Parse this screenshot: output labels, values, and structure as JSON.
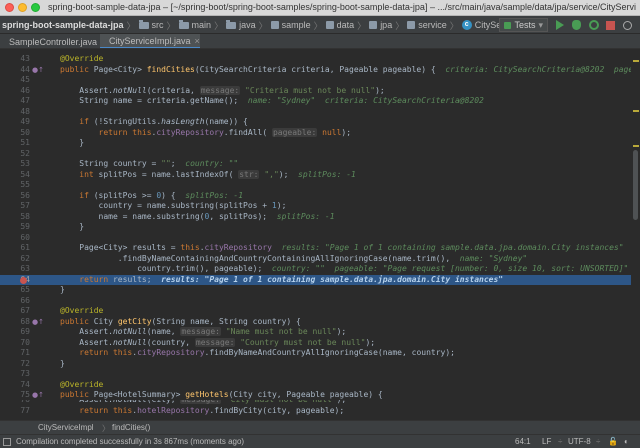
{
  "window": {
    "title": "spring-boot-sample-data-jpa – [~/spring-boot/spring-boot-samples/spring-boot-sample-data-jpa] – .../src/main/java/sample/data/jpa/service/CityServiceImpl"
  },
  "breadcrumbs": [
    "spring-boot-sample-data-jpa",
    "src",
    "main",
    "java",
    "sample",
    "data",
    "jpa",
    "service",
    "CityServiceImpl"
  ],
  "toolbar": {
    "run_config": "Tests"
  },
  "tabs": [
    {
      "label": "SampleController.java",
      "close": "×"
    },
    {
      "label": "CityServiceImpl.java",
      "close": "×"
    }
  ],
  "bottom_breadcrumbs": [
    "CityServiceImpl",
    "findCities()"
  ],
  "status": {
    "message": "Compilation completed successfully in 3s 867ms (moments ago)",
    "position": "64:1",
    "line_sep": "LF",
    "encoding": "UTF-8"
  },
  "colors": {
    "accent": "#4a88c7",
    "highlight": "#2d5687",
    "breakpoint": "#c75450"
  }
}
